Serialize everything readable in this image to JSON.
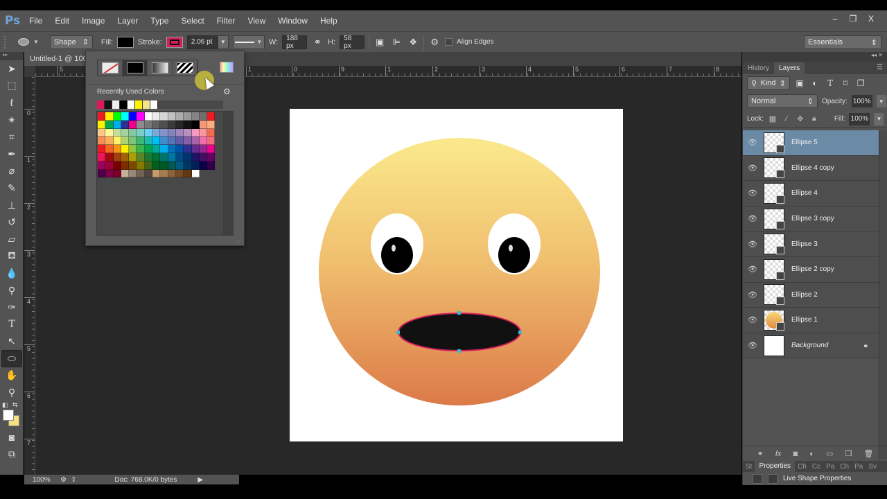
{
  "app": {
    "logo": "Ps"
  },
  "menu": [
    "File",
    "Edit",
    "Image",
    "Layer",
    "Type",
    "Select",
    "Filter",
    "View",
    "Window",
    "Help"
  ],
  "window_controls": {
    "minimize": "‒",
    "restore": "❐",
    "close": "X"
  },
  "options_bar": {
    "tool_mode": "Shape",
    "fill_label": "Fill:",
    "fill_color": "#000000",
    "stroke_label": "Stroke:",
    "stroke_color": "#d21f5d",
    "stroke_width": "2.06 pt",
    "w_label": "W:",
    "width_value": "188 px",
    "h_label": "H:",
    "height_value": "58 px",
    "align_edges_label": "Align Edges",
    "align_edges_checked": false,
    "workspace": "Essentials"
  },
  "document": {
    "tab_title": "Untitled-1 @ 100",
    "ruler_h_labels": [
      "5",
      "1",
      "0",
      "1",
      "2",
      "3",
      "4",
      "5",
      "6",
      "7",
      "8",
      "9"
    ],
    "ruler_v_labels": [
      "0",
      "1",
      "2",
      "3",
      "4",
      "5",
      "6",
      "7"
    ]
  },
  "swatch_popup": {
    "fill_types": [
      "no-color",
      "solid-color",
      "gradient",
      "pattern"
    ],
    "selected_fill_type": "solid-color",
    "recent_label": "Recently Used Colors",
    "recent_colors": [
      "#e0185a",
      "#111111",
      "#eeeeee",
      "#000000",
      "#ffffff",
      "#fff200",
      "#f6e48a",
      "#ffffff"
    ],
    "swatches": [
      [
        "#ed1c24",
        "#fff200",
        "#00ff00",
        "#00ffff",
        "#0000ff",
        "#ff00ff",
        "#ffffff",
        "#ebebeb",
        "#d6d6d6",
        "#c2c2c2",
        "#adadad",
        "#999999",
        "#858585",
        "#707070",
        "#ed1c24"
      ],
      [
        "#fff200",
        "#00a651",
        "#00aeef",
        "#2e3192",
        "#ec008c",
        "#8c8c8c",
        "#787878",
        "#636363",
        "#4f4f4f",
        "#3b3b3b",
        "#262626",
        "#121212",
        "#000000",
        "#f7977a",
        "#f9ad81"
      ],
      [
        "#fdc68a",
        "#fff79a",
        "#c4df9b",
        "#a3d39c",
        "#82ca9d",
        "#7bcdc8",
        "#6ecff6",
        "#7ea7d8",
        "#8393ca",
        "#8781bd",
        "#a187be",
        "#bc8dbf",
        "#f49ac2",
        "#f6989d",
        "#f26c4f"
      ],
      [
        "#f68e55",
        "#fbaf5c",
        "#fff467",
        "#acd372",
        "#7cc576",
        "#3bb878",
        "#1abbb4",
        "#00bff3",
        "#438ccb",
        "#5574b9",
        "#605ca8",
        "#855fa8",
        "#a763a8",
        "#f06eaa",
        "#f26d7d"
      ],
      [
        "#ed1c24",
        "#f26522",
        "#f7941d",
        "#fff200",
        "#8dc73f",
        "#39b54a",
        "#00a651",
        "#00a99d",
        "#00aeef",
        "#0072bc",
        "#0054a6",
        "#2e3192",
        "#662d91",
        "#92278f",
        "#ec008c"
      ],
      [
        "#ed145b",
        "#9e0b0f",
        "#a0410d",
        "#a36209",
        "#aba000",
        "#598527",
        "#1a7b30",
        "#007236",
        "#00746b",
        "#0076a3",
        "#004b80",
        "#003471",
        "#1b1464",
        "#440e62",
        "#630460"
      ],
      [
        "#9e005d",
        "#9e0039",
        "#790000",
        "#7b2e00",
        "#7d4900",
        "#827b00",
        "#406618",
        "#005e20",
        "#005826",
        "#005952",
        "#005b7f",
        "#003663",
        "#002157",
        "#0d004c",
        "#32004b"
      ],
      [
        "#4b0049",
        "#7b0046",
        "#7a0026",
        "#c7b299",
        "#998675",
        "#736357",
        "#534741",
        "#c69c6d",
        "#a67c52",
        "#8c6239",
        "#754c24",
        "#603913",
        "#ffffff"
      ]
    ]
  },
  "status_bar": {
    "zoom": "100%",
    "doc_info": "Doc: 768.0K/0 bytes"
  },
  "layers_panel": {
    "tabs": [
      "History",
      "Layers"
    ],
    "active_tab": "Layers",
    "filter_kind": "Kind",
    "blend_mode": "Normal",
    "opacity_label": "Opacity:",
    "opacity": "100%",
    "lock_label": "Lock:",
    "fill_label": "Fill:",
    "fill": "100%",
    "layers": [
      {
        "name": "Ellipse 5",
        "selected": true,
        "thumb": "shape",
        "visible": true
      },
      {
        "name": "Ellipse 4 copy",
        "selected": false,
        "thumb": "shape",
        "visible": true
      },
      {
        "name": "Ellipse 4",
        "selected": false,
        "thumb": "shape",
        "visible": true
      },
      {
        "name": "Ellipse 3 copy",
        "selected": false,
        "thumb": "shape",
        "visible": true
      },
      {
        "name": "Ellipse 3",
        "selected": false,
        "thumb": "shape",
        "visible": true
      },
      {
        "name": "Ellipse 2 copy",
        "selected": false,
        "thumb": "shape",
        "visible": true
      },
      {
        "name": "Ellipse 2",
        "selected": false,
        "thumb": "shape",
        "visible": true
      },
      {
        "name": "Ellipse 1",
        "selected": false,
        "thumb": "orange",
        "visible": true
      },
      {
        "name": "Background",
        "selected": false,
        "thumb": "white",
        "visible": true,
        "locked": true
      }
    ]
  },
  "properties_panel": {
    "tabs": [
      "St",
      "Properties",
      "Ch",
      "Cc",
      "Pa",
      "Ch",
      "Pa",
      "Sv"
    ],
    "active_tab": "Properties",
    "content_title": "Live Shape Properties"
  },
  "artwork": {
    "face_gradient_top": "#fbe98c",
    "face_gradient_bottom": "#dc7a48",
    "eye_white": "#ffffff",
    "pupil": "#000000",
    "mouth_fill": "#111111",
    "mouth_stroke": "#d21f5d",
    "anchor_color": "#3fb8c9"
  }
}
